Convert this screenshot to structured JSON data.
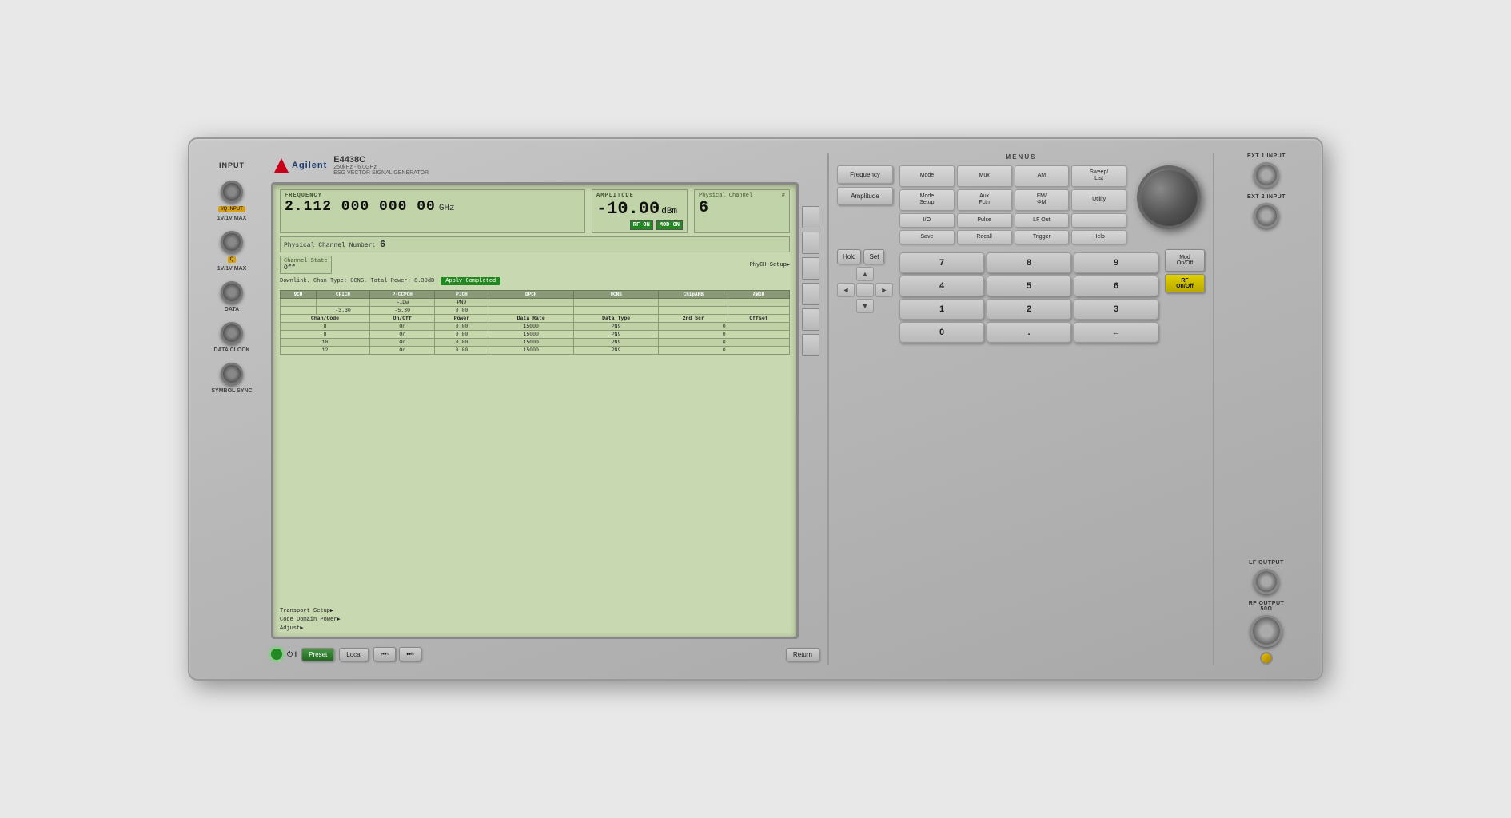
{
  "instrument": {
    "brand": "Agilent",
    "model": "E4438C",
    "spec": "250kHz - 6.0GHz",
    "description": "ESG VECTOR SIGNAL GENERATOR"
  },
  "display": {
    "frequency": {
      "label": "FREQUENCY",
      "value": "2.112 000 000 00",
      "unit": "GHz"
    },
    "amplitude": {
      "label": "AMPLITUDE",
      "value": "-10.00",
      "unit": "dBm"
    },
    "rf_on": "RF ON",
    "mod_on": "MOD ON",
    "physical_channel": {
      "label": "Physical Channel",
      "num_label": "#",
      "value": "6"
    },
    "physical_channel_number": {
      "label": "Physical Channel Number:",
      "value": "6"
    },
    "channel_state": {
      "label": "Channel State",
      "value": "Off"
    },
    "phych_setup": "PhyCH Setup▶",
    "transport_setup": "Transport Setup▶",
    "code_domain_power": "Code Domain Power▶",
    "adjust": "Adjust▶",
    "downlink_info": "Downlink. Chan Type: 0CNS. Total Power: 8.30dB",
    "apply_completed": "Apply Completed",
    "table": {
      "headers": [
        "9CH",
        "CPICH",
        "P-CCPCH",
        "PICH",
        "DPCH",
        "0CNS",
        "ChipARB",
        "AWGN"
      ],
      "sub_headers": [
        "",
        "",
        "FIDW",
        "PN9",
        "",
        "",
        "",
        ""
      ],
      "power_row": [
        "",
        "-3.30",
        "-5.30",
        "0.00",
        "",
        "",
        "",
        ""
      ],
      "col_headers2": [
        "Chan",
        "On/Code",
        "Off",
        "Power",
        "Data Rate",
        "Data Type",
        "2nd Scr Offset"
      ],
      "rows": [
        [
          "8",
          "On",
          "0.00",
          "15000",
          "PN9",
          "0"
        ],
        [
          "8",
          "On",
          "0.00",
          "15000",
          "PN9",
          "0"
        ],
        [
          "10",
          "On",
          "0.00",
          "15000",
          "PN9",
          "0"
        ],
        [
          "12",
          "On",
          "0.00",
          "15000",
          "PN9",
          "0"
        ]
      ]
    }
  },
  "left_panel": {
    "input_label": "INPUT",
    "connectors": [
      {
        "label": "I/Q INPUT",
        "sublabel": "1V/1V MAX"
      },
      {
        "label": "Q",
        "sublabel": "1V/1V MAX"
      },
      {
        "label": "DATA",
        "sublabel": ""
      },
      {
        "label": "DATA CLOCK",
        "sublabel": ""
      },
      {
        "label": "SYMBOL SYNC",
        "sublabel": ""
      }
    ]
  },
  "bottom_controls": {
    "power_symbol": "⏻ I",
    "preset_btn": "Preset",
    "local_btn": "Local",
    "return_btn": "Return"
  },
  "menus": {
    "label": "MENUS",
    "buttons": [
      "Mode",
      "Mux",
      "AM",
      "Sweep/List",
      "Mode Setup",
      "Aux Fctn",
      "FM/ΦM",
      "Utility",
      "I/O",
      "Pulse",
      "LF Out",
      "",
      "Save",
      "Recall",
      "Trigger",
      "Help"
    ]
  },
  "freq_amp_controls": {
    "frequency_btn": "Frequency",
    "amplitude_btn": "Amplitude"
  },
  "numpad": {
    "keys": [
      "7",
      "8",
      "9",
      "4",
      "5",
      "6",
      "1",
      "2",
      "3",
      "0",
      ".",
      "←"
    ]
  },
  "nav_buttons": {
    "hold": "Hold",
    "set": "Set",
    "mod_on_off": "Mod\nOn/Off",
    "rf_on_off": "RF\nOn/Off"
  },
  "far_right": {
    "ext1_input_label": "EXT 1 INPUT",
    "ext2_input_label": "EXT 2 INPUT",
    "lf_output_label": "LF OUTPUT",
    "rf_output_label": "RF OUTPUT\n50Ω"
  },
  "side_buttons": {
    "count": 6
  }
}
